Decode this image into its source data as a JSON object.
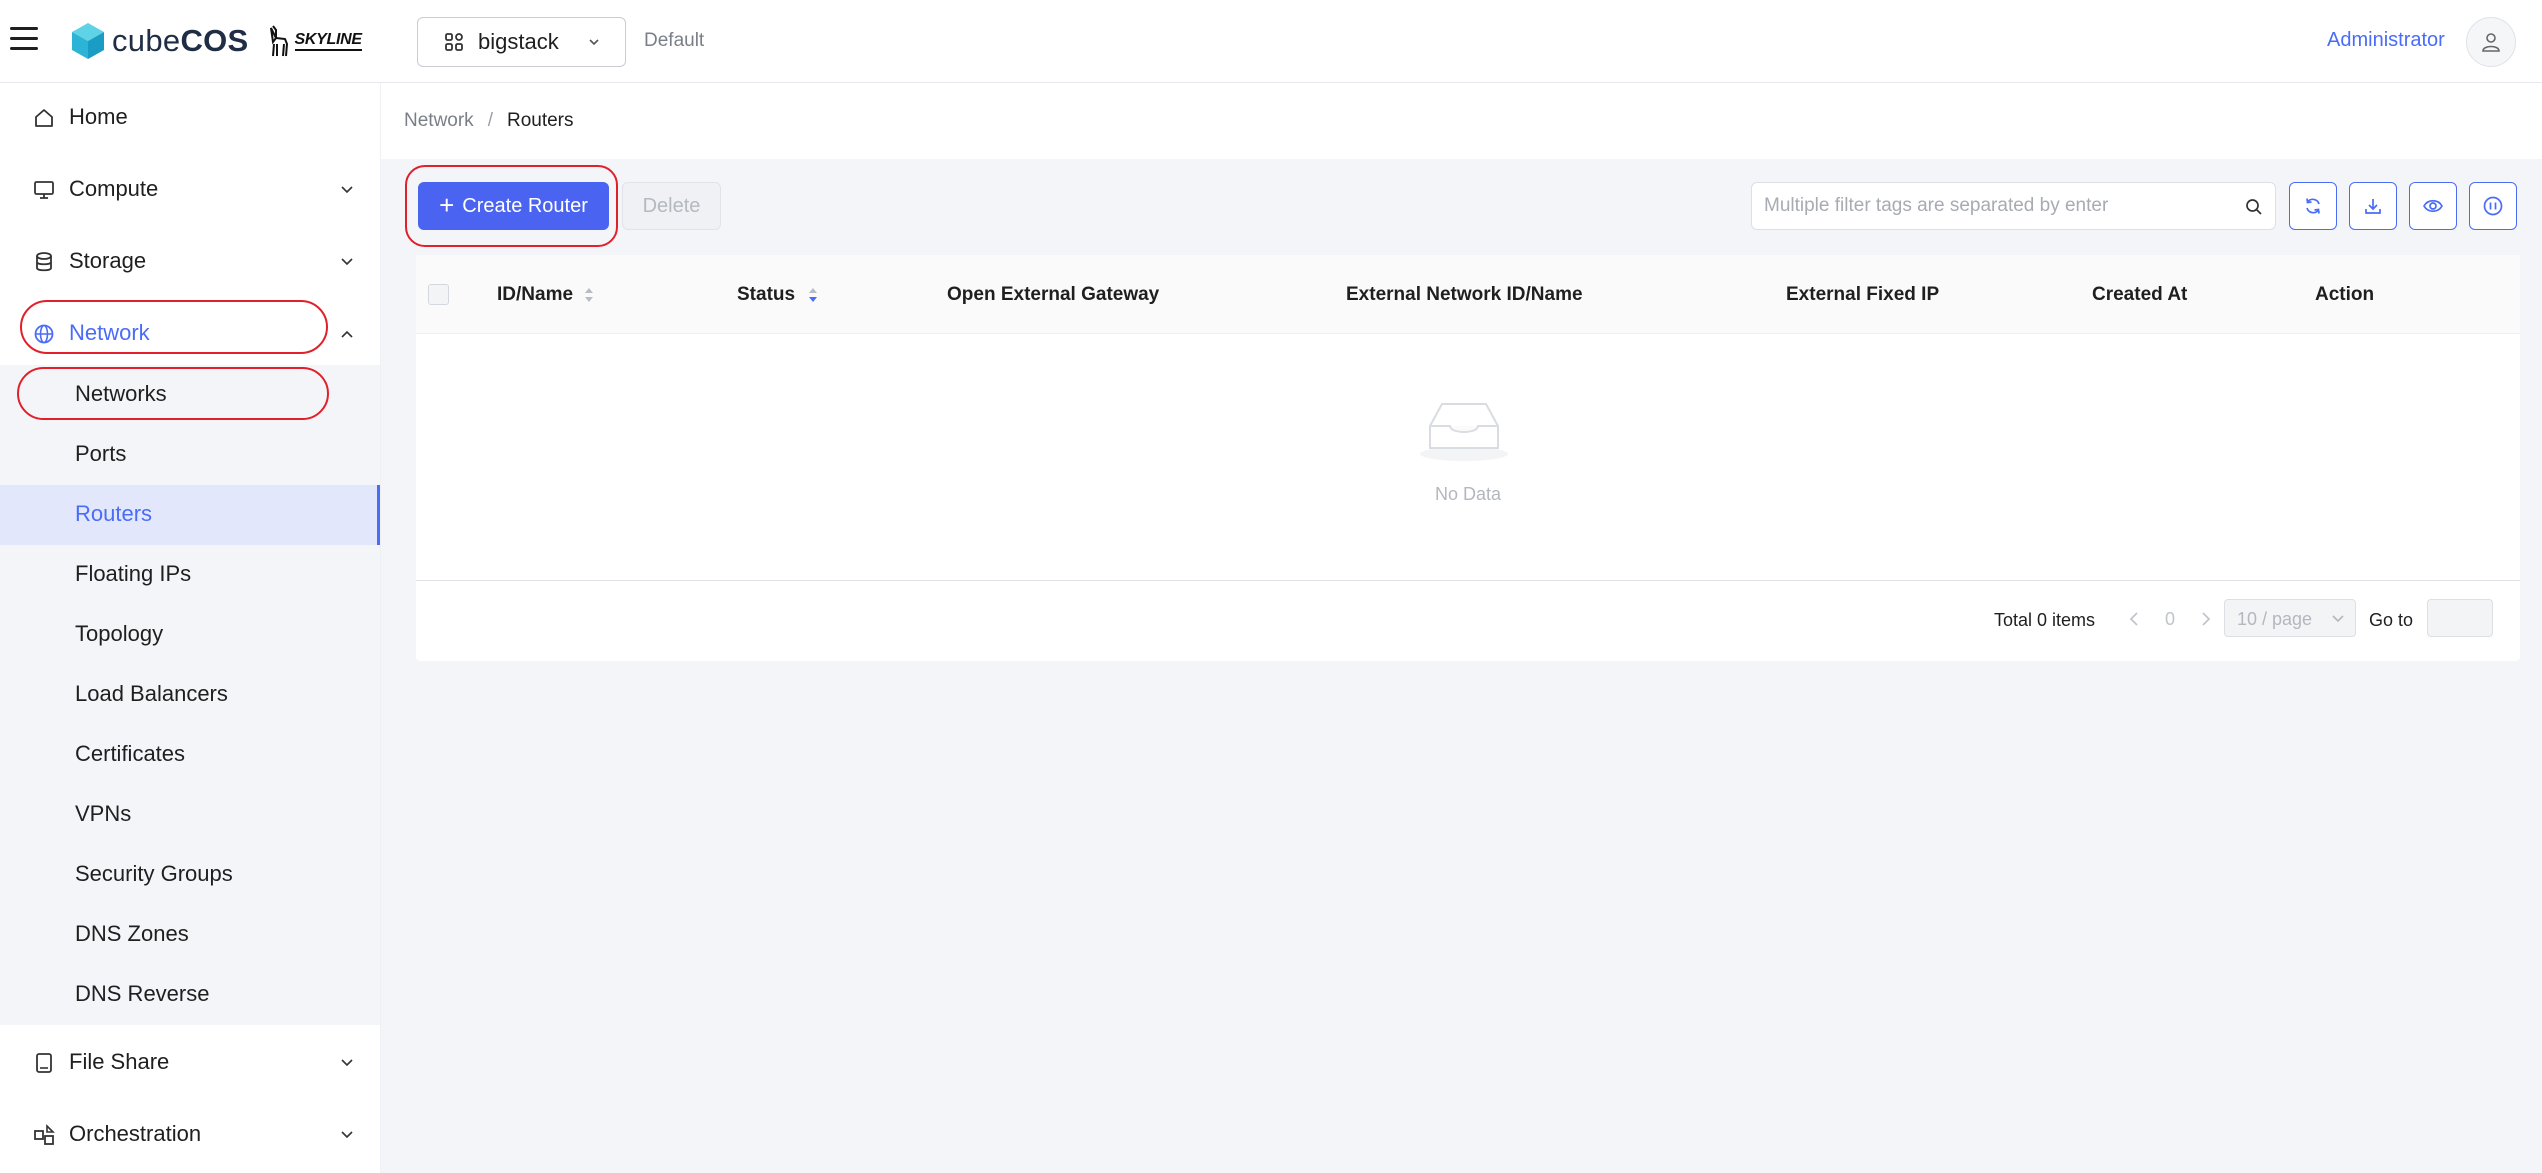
{
  "header": {
    "brand_cube": "cube",
    "brand_cos": "COS",
    "skyline": "SKYLINE",
    "project": "bigstack",
    "domain": "Default",
    "user": "Administrator"
  },
  "sidebar": {
    "items": [
      {
        "label": "Home",
        "icon": "home-icon"
      },
      {
        "label": "Compute",
        "icon": "monitor-icon"
      },
      {
        "label": "Storage",
        "icon": "database-icon"
      },
      {
        "label": "Network",
        "icon": "globe-icon"
      },
      {
        "label": "File Share",
        "icon": "file-icon"
      },
      {
        "label": "Orchestration",
        "icon": "orchestration-icon"
      }
    ],
    "network_sub": [
      "Networks",
      "Ports",
      "Routers",
      "Floating IPs",
      "Topology",
      "Load Balancers",
      "Certificates",
      "VPNs",
      "Security Groups",
      "DNS Zones",
      "DNS Reverse"
    ],
    "active_item": "Network",
    "selected_sub": "Routers"
  },
  "breadcrumb": {
    "parent": "Network",
    "separator": "/",
    "current": "Routers"
  },
  "toolbar": {
    "create_label": "Create Router",
    "delete_label": "Delete",
    "search_placeholder": "Multiple filter tags are separated by enter"
  },
  "table": {
    "columns": [
      "ID/Name",
      "Status",
      "Open External Gateway",
      "External Network ID/Name",
      "External Fixed IP",
      "Created At",
      "Action"
    ],
    "rows": [],
    "empty_text": "No Data"
  },
  "pagination": {
    "total": "Total 0 items",
    "page": "0",
    "page_size": "10 / page",
    "goto_label": "Go to"
  },
  "colors": {
    "accent": "#4a63f0",
    "highlight_ring": "#e0202a",
    "selected_bg": "#e3e7fb"
  }
}
